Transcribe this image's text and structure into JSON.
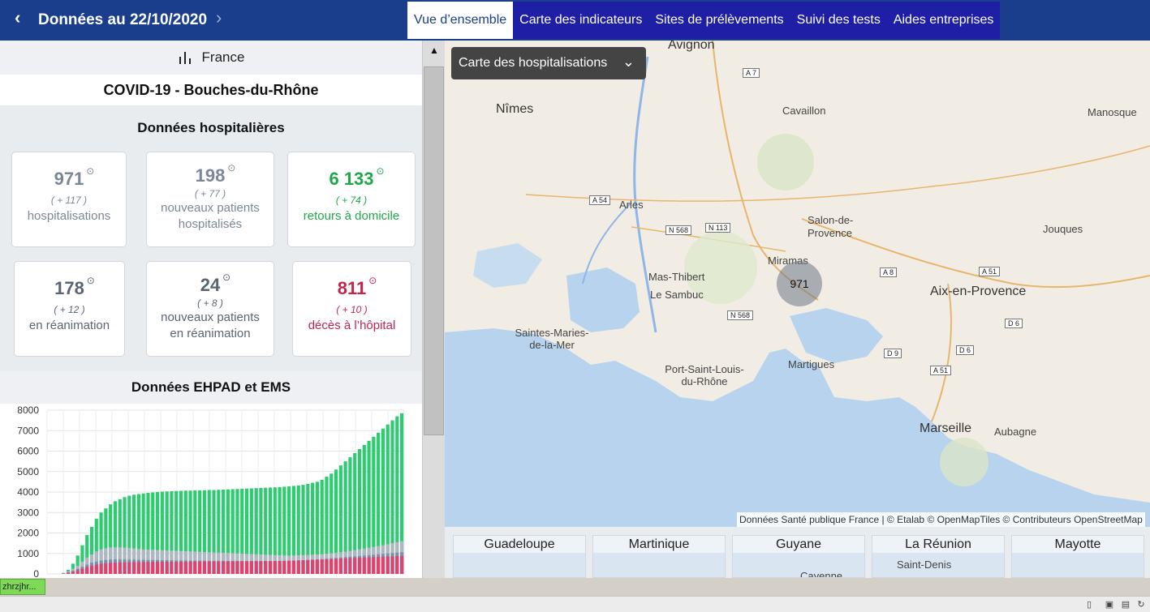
{
  "header": {
    "prev_icon": "‹",
    "date_title": "Données au 22/10/2020",
    "next_icon": "›",
    "tabs": [
      "Vue d’ensemble",
      "Carte des indicateurs",
      "Sites de prélèvements",
      "Suivi des tests",
      "Aides entreprises"
    ]
  },
  "left": {
    "scope_label": "France",
    "page_title": "COVID-19 - Bouches-du-Rhône",
    "hosp_title": "Données hospitalières",
    "cards": [
      {
        "value": "971",
        "delta": "( + 117 )",
        "label": "hospitalisations"
      },
      {
        "value": "198",
        "delta": "( + 77 )",
        "label": "nouveaux patients hospitalisés"
      },
      {
        "value": "6 133",
        "delta": "( + 74 )",
        "label": "retours à domicile"
      },
      {
        "value": "178",
        "delta": "( + 12 )",
        "label": "en réanimation"
      },
      {
        "value": "24",
        "delta": "( + 8 )",
        "label": "nouveaux patients en réanimation"
      },
      {
        "value": "811",
        "delta": "( + 10 )",
        "label": "décès à l’hôpital"
      }
    ],
    "info_icon": "⊙",
    "ehpad_title": "Données EHPAD et EMS"
  },
  "chart_data": {
    "type": "bar",
    "title": "",
    "xlabel": "",
    "ylabel": "",
    "ylim": [
      0,
      8000
    ],
    "y_ticks": [
      "8000",
      "7000",
      "6000",
      "5000",
      "4000",
      "3000",
      "2000",
      "1000",
      "0"
    ],
    "grid": true,
    "stacked": true,
    "colors": {
      "green": "#2ecc71",
      "grey": "#b0b6c3",
      "blue": "#7c8fb0",
      "red": "#e0416e"
    },
    "series": [
      {
        "color": "green",
        "values": [
          0,
          0,
          0,
          50,
          200,
          500,
          900,
          1400,
          1900,
          2300,
          2700,
          3000,
          3200,
          3400,
          3550,
          3650,
          3750,
          3820,
          3870,
          3900,
          3930,
          3960,
          3980,
          4000,
          4020,
          4030,
          4040,
          4050,
          4060,
          4070,
          4070,
          4080,
          4080,
          4090,
          4100,
          4100,
          4110,
          4120,
          4130,
          4140,
          4150,
          4160,
          4170,
          4180,
          4190,
          4200,
          4210,
          4220,
          4230,
          4240,
          4260,
          4280,
          4300,
          4320,
          4350,
          4400,
          4450,
          4500,
          4600,
          4750,
          4900,
          5100,
          5300,
          5500,
          5700,
          5900,
          6100,
          6300,
          6500,
          6700,
          6900,
          7100,
          7300,
          7500,
          7700,
          7850
        ]
      },
      {
        "color": "grey",
        "values": [
          0,
          0,
          0,
          30,
          120,
          250,
          400,
          600,
          800,
          950,
          1100,
          1200,
          1250,
          1300,
          1300,
          1300,
          1280,
          1260,
          1240,
          1220,
          1200,
          1190,
          1180,
          1170,
          1160,
          1150,
          1140,
          1130,
          1120,
          1110,
          1100,
          1090,
          1080,
          1070,
          1060,
          1050,
          1040,
          1030,
          1020,
          1010,
          1000,
          990,
          980,
          970,
          960,
          950,
          940,
          930,
          920,
          910,
          900,
          900,
          900,
          910,
          920,
          930,
          940,
          950,
          970,
          990,
          1010,
          1030,
          1060,
          1090,
          1120,
          1160,
          1200,
          1240,
          1280,
          1320,
          1360,
          1400,
          1450,
          1500,
          1550,
          1600
        ]
      },
      {
        "color": "blue",
        "values": [
          0,
          0,
          0,
          20,
          80,
          150,
          250,
          350,
          450,
          550,
          600,
          650,
          680,
          700,
          710,
          710,
          710,
          700,
          700,
          690,
          690,
          680,
          680,
          680,
          670,
          670,
          670,
          660,
          660,
          660,
          650,
          650,
          650,
          650,
          640,
          640,
          640,
          640,
          630,
          630,
          630,
          630,
          620,
          620,
          620,
          610,
          610,
          600,
          600,
          600,
          600,
          600,
          610,
          620,
          640,
          660,
          680,
          700,
          720,
          740,
          760,
          780,
          800,
          820,
          840,
          860,
          880,
          900,
          920,
          940,
          960,
          980,
          1000,
          1020,
          1040,
          1060
        ]
      },
      {
        "color": "red",
        "values": [
          0,
          0,
          0,
          10,
          50,
          100,
          180,
          260,
          340,
          400,
          450,
          490,
          520,
          540,
          550,
          560,
          565,
          570,
          575,
          580,
          580,
          585,
          585,
          590,
          590,
          590,
          595,
          595,
          600,
          600,
          600,
          605,
          605,
          605,
          610,
          610,
          610,
          615,
          615,
          615,
          620,
          620,
          620,
          625,
          625,
          625,
          630,
          630,
          630,
          635,
          640,
          645,
          650,
          660,
          670,
          680,
          690,
          700,
          710,
          720,
          730,
          740,
          750,
          760,
          770,
          780,
          790,
          800,
          810,
          820,
          830,
          840,
          850,
          860,
          870,
          880
        ]
      }
    ]
  },
  "map": {
    "selector_label": "Carte des hospitalisations",
    "selector_icon": "chevron-down",
    "cluster_value": "971",
    "attribution": "Données Santé publique France | © Etalab © OpenMapTiles © Contributeurs OpenStreetMap",
    "places": [
      {
        "name": "Avignon",
        "big": true
      },
      {
        "name": "Nîmes",
        "big": true
      },
      {
        "name": "Cavaillon",
        "big": false
      },
      {
        "name": "Manosque",
        "big": false
      },
      {
        "name": "Arles",
        "big": false
      },
      {
        "name": "Salon-de-Provence",
        "big": false
      },
      {
        "name": "Jouques",
        "big": false
      },
      {
        "name": "Miramas",
        "big": false
      },
      {
        "name": "Mas-Thibert",
        "big": false
      },
      {
        "name": "Le Sambuc",
        "big": false
      },
      {
        "name": "Aix-en-Provence",
        "big": true
      },
      {
        "name": "Saintes-Maries-de-la-Mer",
        "big": false
      },
      {
        "name": "Martigues",
        "big": false
      },
      {
        "name": "Port-Saint-Louis-du-Rhône",
        "big": false
      },
      {
        "name": "Marseille",
        "big": true
      },
      {
        "name": "Aubagne",
        "big": false
      }
    ],
    "roads": [
      "A 7",
      "A 54",
      "N 568",
      "N 113",
      "A 8",
      "A 51",
      "N 568",
      "D 6",
      "D 9",
      "D 6",
      "A 51"
    ]
  },
  "overseas": [
    {
      "name": "Guadeloupe",
      "city": ""
    },
    {
      "name": "Martinique",
      "city": ""
    },
    {
      "name": "Guyane",
      "city": "Cayenne"
    },
    {
      "name": "La Réunion",
      "city": "Saint-Denis"
    },
    {
      "name": "Mayotte",
      "city": ""
    }
  ],
  "statusbar": {
    "task_label": "zhrzjhr..."
  }
}
